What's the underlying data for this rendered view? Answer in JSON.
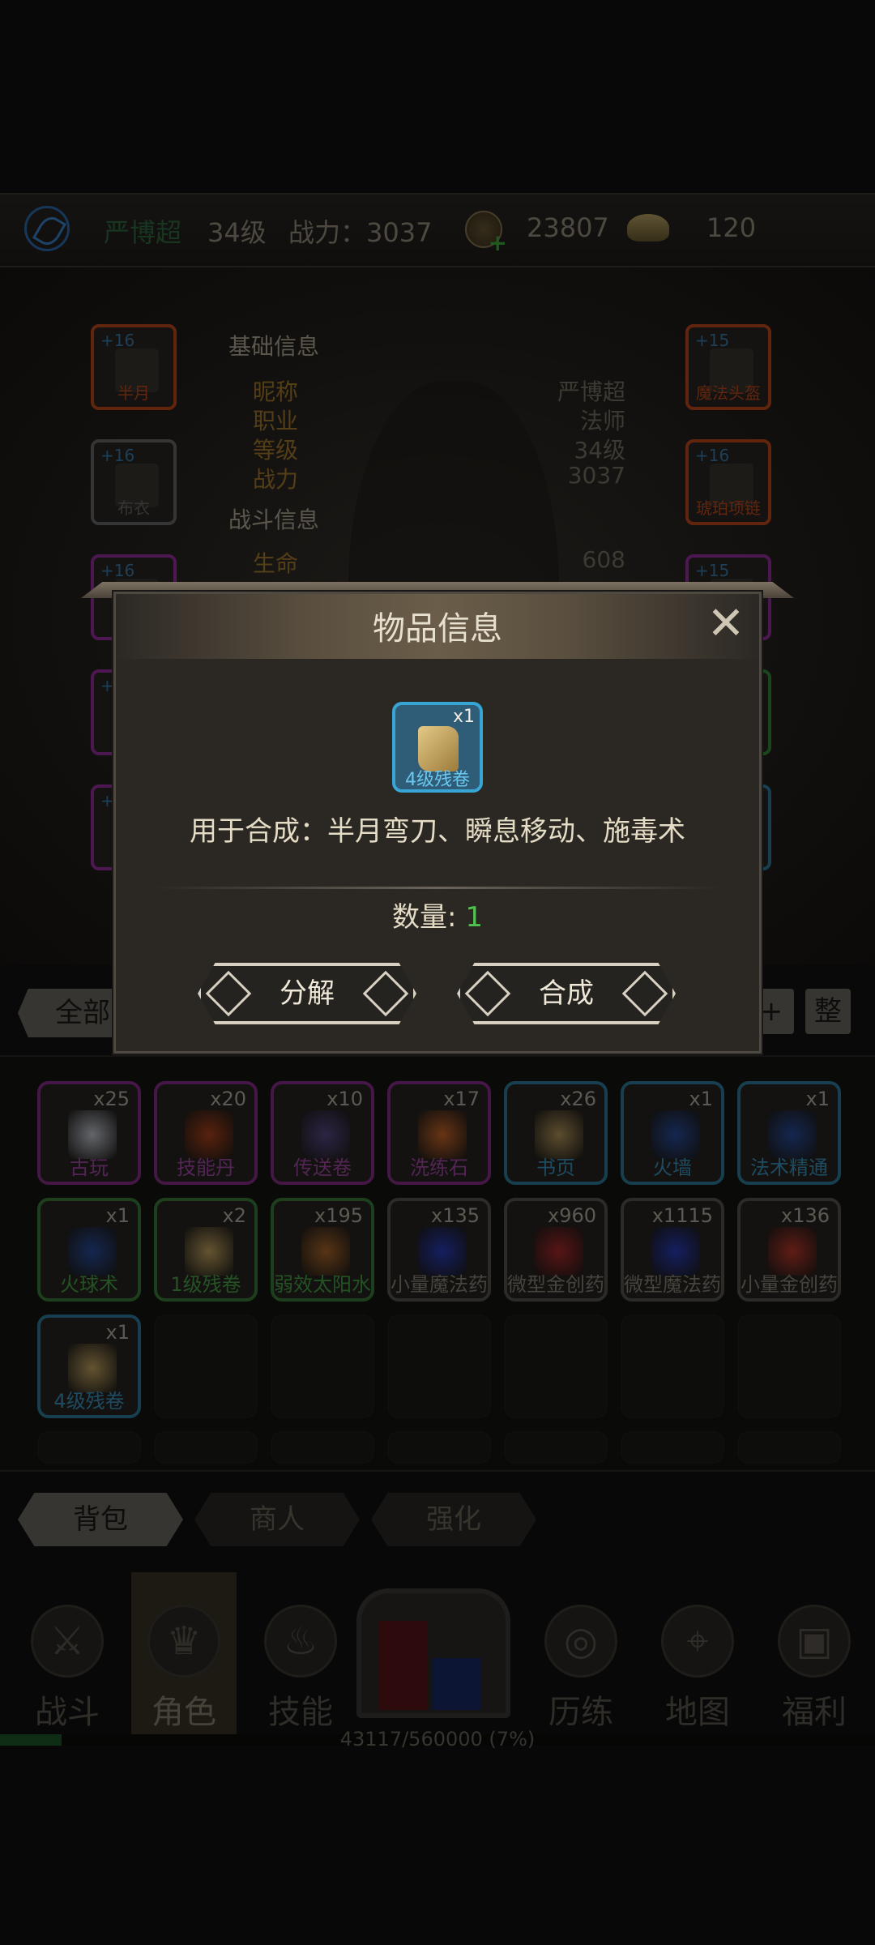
{
  "status_bar": {
    "player_name": "严博超",
    "level": "34级",
    "power": "战力：3037",
    "copper": "23807",
    "gold": "120"
  },
  "equipment": {
    "left": [
      {
        "plus": "+16",
        "name": "半月",
        "quality_color": "#c24a1c"
      },
      {
        "plus": "+16",
        "name": "布衣",
        "quality_color": "#6a6a6a"
      },
      {
        "plus": "+16",
        "name": "",
        "quality_color": "#9a2fa2"
      },
      {
        "plus": "+",
        "name": "",
        "quality_color": "#9a2fa2"
      },
      {
        "plus": "+",
        "name": "",
        "quality_color": "#9a2fa2"
      }
    ],
    "right": [
      {
        "plus": "+15",
        "name": "魔法头盔",
        "quality_color": "#c24a1c"
      },
      {
        "plus": "+16",
        "name": "琥珀项链",
        "quality_color": "#c24a1c"
      },
      {
        "plus": "+15",
        "name": "",
        "quality_color": "#9a2fa2"
      },
      {
        "plus": "",
        "name": "",
        "quality_color": "#3a8a3a"
      },
      {
        "plus": "",
        "name": "",
        "quality_color": "#2f7f9f"
      }
    ]
  },
  "basic_info": {
    "title": "基础信息",
    "rows": [
      {
        "k": "昵称",
        "v": "严博超"
      },
      {
        "k": "职业",
        "v": "法师"
      },
      {
        "k": "等级",
        "v": "34级"
      },
      {
        "k": "战力",
        "v": "3037"
      }
    ]
  },
  "battle_info": {
    "title": "战斗信息",
    "rows": [
      {
        "k": "生命",
        "v": "608"
      }
    ]
  },
  "filter": {
    "all_label": "全部",
    "add_label": "+",
    "sort_label": "整"
  },
  "inventory": {
    "items": [
      {
        "count": "x25",
        "name": "古玩",
        "quality": "purple",
        "icon": "vase-icon",
        "icon_color": "#c8ccd6"
      },
      {
        "count": "x20",
        "name": "技能丹",
        "quality": "purple",
        "icon": "pill-icon",
        "icon_color": "#b2431c"
      },
      {
        "count": "x10",
        "name": "传送卷",
        "quality": "purple",
        "icon": "scroll-icon",
        "icon_color": "#5a4a8a"
      },
      {
        "count": "x17",
        "name": "洗练石",
        "quality": "purple",
        "icon": "stone-icon",
        "icon_color": "#d06a2a"
      },
      {
        "count": "x26",
        "name": "书页",
        "quality": "blue",
        "icon": "page-icon",
        "icon_color": "#b89a5c"
      },
      {
        "count": "x1",
        "name": "火墙",
        "quality": "blue",
        "icon": "book-icon",
        "icon_color": "#2a4fa0"
      },
      {
        "count": "x1",
        "name": "法术精通",
        "quality": "blue",
        "icon": "book-icon",
        "icon_color": "#2a4fa0"
      },
      {
        "count": "x1",
        "name": "火球术",
        "quality": "green",
        "icon": "book-icon",
        "icon_color": "#2a4fa0"
      },
      {
        "count": "x2",
        "name": "1级残卷",
        "quality": "green",
        "icon": "scroll-icon",
        "icon_color": "#c9a861"
      },
      {
        "count": "x195",
        "name": "弱效太阳水",
        "quality": "green",
        "icon": "potion-icon",
        "icon_color": "#b06a2a"
      },
      {
        "count": "x135",
        "name": "小量魔法药",
        "quality": "gray",
        "icon": "potion-icon",
        "icon_color": "#2a3fc0"
      },
      {
        "count": "x960",
        "name": "微型金创药",
        "quality": "gray",
        "icon": "potion-icon",
        "icon_color": "#b02a2a"
      },
      {
        "count": "x1115",
        "name": "微型魔法药",
        "quality": "gray",
        "icon": "potion-icon",
        "icon_color": "#2a3fc0"
      },
      {
        "count": "x136",
        "name": "小量金创药",
        "quality": "gray",
        "icon": "potion-icon",
        "icon_color": "#c0392b"
      },
      {
        "count": "x1",
        "name": "4级残卷",
        "quality": "blue",
        "icon": "scroll-icon",
        "icon_color": "#c9a861"
      }
    ]
  },
  "bottom_tabs": [
    {
      "label": "背包",
      "active": true
    },
    {
      "label": "商人",
      "active": false
    },
    {
      "label": "强化",
      "active": false
    }
  ],
  "nav": [
    {
      "label": "战斗",
      "icon": "swords-icon"
    },
    {
      "label": "角色",
      "icon": "crown-icon",
      "selected": true
    },
    {
      "label": "技能",
      "icon": "flame-icon"
    },
    {
      "label": "历练",
      "icon": "vortex-icon"
    },
    {
      "label": "地图",
      "icon": "map-icon"
    },
    {
      "label": "福利",
      "icon": "chest-icon"
    }
  ],
  "xp": {
    "text": "43117/560000 (7%)",
    "fraction": 0.07
  },
  "modal": {
    "title": "物品信息",
    "item": {
      "count": "x1",
      "name": "4级残卷"
    },
    "description": "用于合成：半月弯刀、瞬息移动、施毒术",
    "quantity_label": "数量:",
    "quantity_value": "1",
    "decompose_label": "分解",
    "combine_label": "合成"
  }
}
